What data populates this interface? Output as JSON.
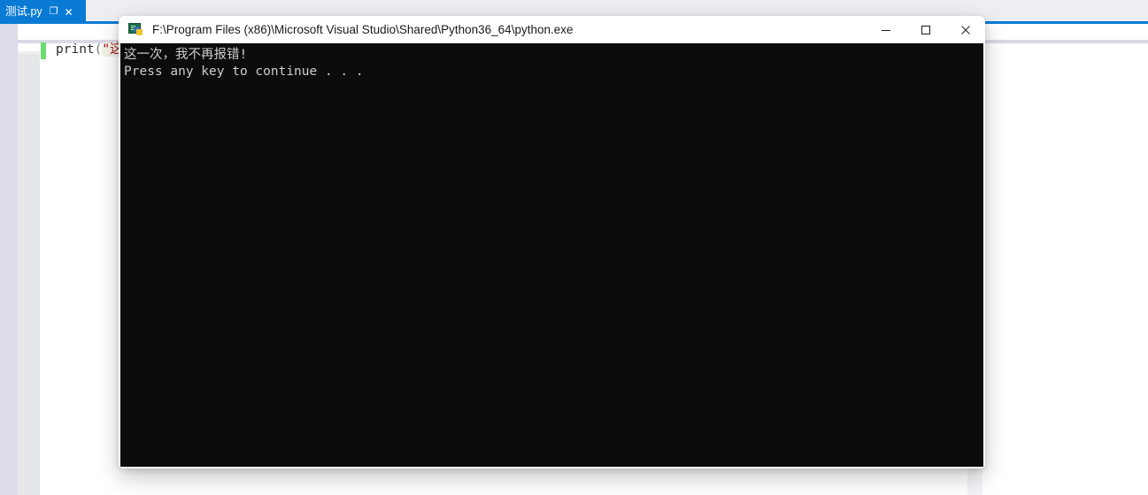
{
  "ide": {
    "tab": {
      "label": "测试.py",
      "pin_icon": "pin-icon",
      "close_icon": "close-icon"
    },
    "editor": {
      "code_line": {
        "function": "print",
        "open_paren": "(",
        "string_fragment": "\"这一"
      },
      "change_bar_color": "#6cdc72"
    },
    "accent_color": "#0a7bd4"
  },
  "console_window": {
    "icon": "python-console-icon",
    "title": "F:\\Program Files (x86)\\Microsoft Visual Studio\\Shared\\Python36_64\\python.exe",
    "buttons": {
      "minimize": "Minimize",
      "maximize": "Maximize",
      "close": "Close"
    },
    "output": {
      "line1": "这一次，我不再报错!",
      "line2": "Press any key to continue . . ."
    },
    "background_color": "#0c0c0c",
    "text_color": "#cccccc"
  }
}
